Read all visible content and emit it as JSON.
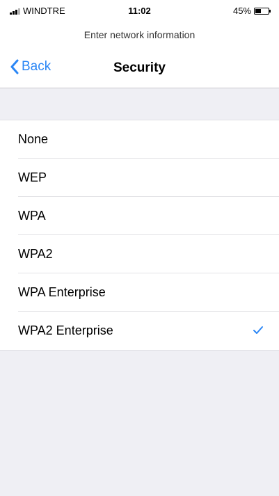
{
  "status_bar": {
    "carrier": "WINDTRE",
    "time": "11:02",
    "battery": "45%",
    "battery_level": 0.45
  },
  "header": {
    "network_title": "Enter network information"
  },
  "nav": {
    "back_label": "Back",
    "title": "Security"
  },
  "options": [
    {
      "label": "None",
      "selected": false
    },
    {
      "label": "WEP",
      "selected": false
    },
    {
      "label": "WPA",
      "selected": false
    },
    {
      "label": "WPA2",
      "selected": false
    },
    {
      "label": "WPA Enterprise",
      "selected": false
    },
    {
      "label": "WPA2 Enterprise",
      "selected": true
    }
  ],
  "colors": {
    "accent": "#2a86f5",
    "background": "#efeff4"
  },
  "icons": {
    "back": "chevron-left-icon",
    "check": "checkmark-icon",
    "signal": "signal-strength-icon",
    "battery": "battery-icon"
  }
}
